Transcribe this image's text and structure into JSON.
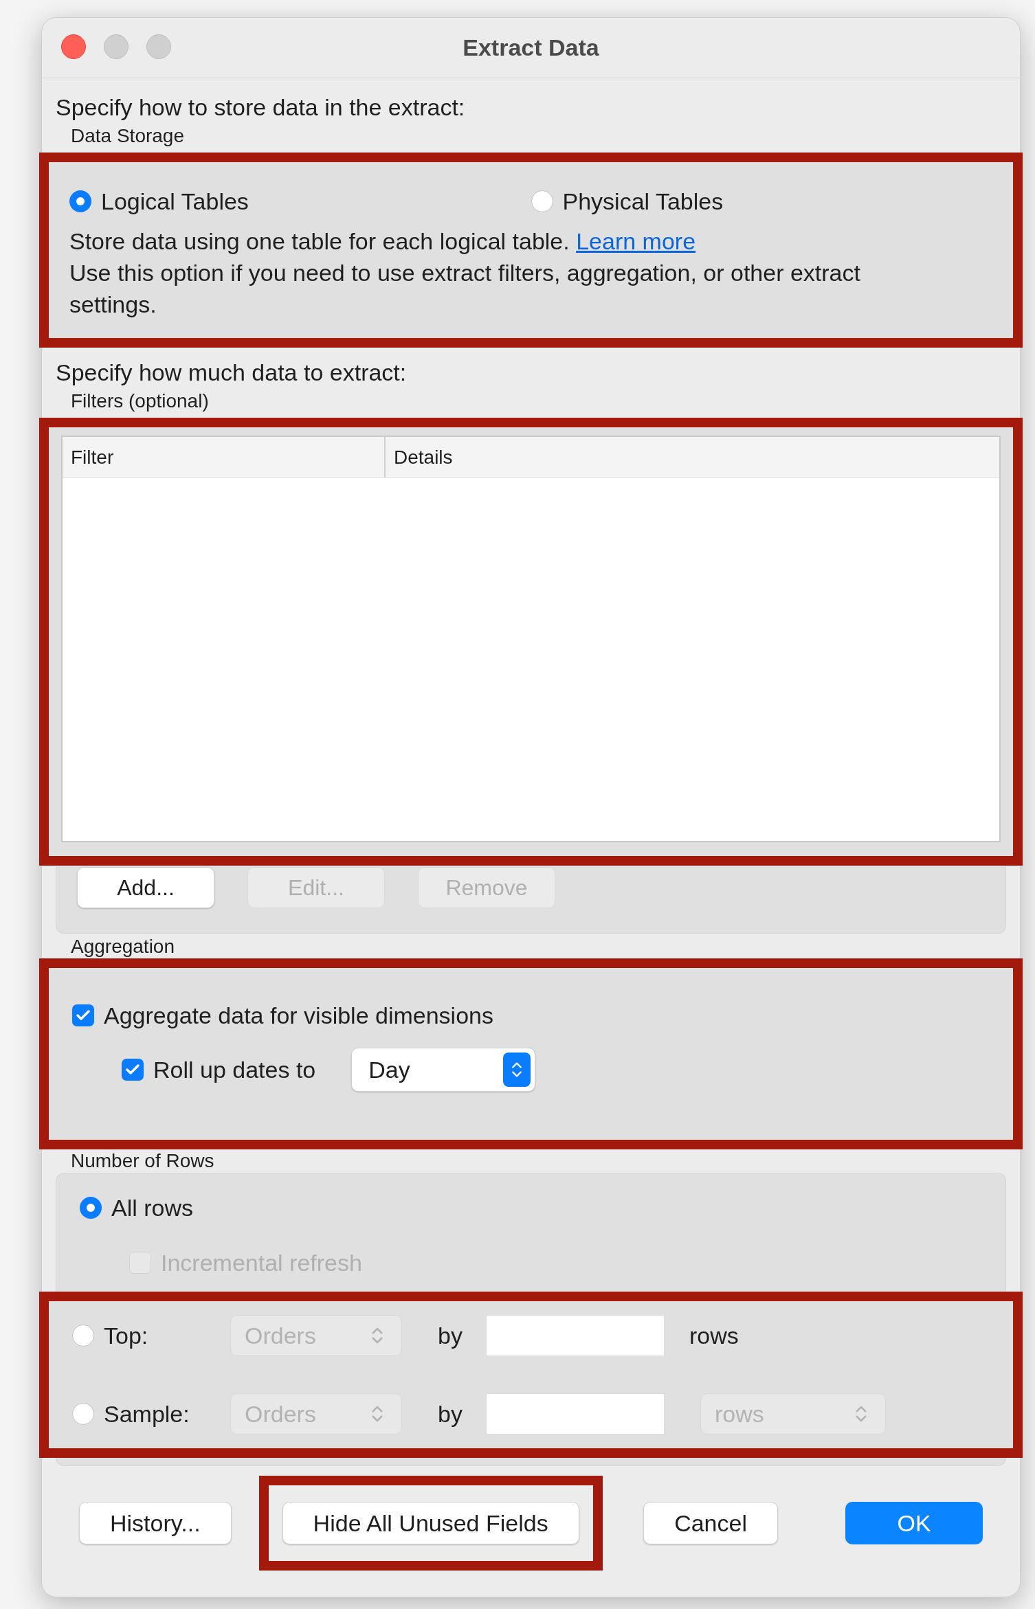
{
  "window": {
    "title": "Extract Data"
  },
  "storage": {
    "heading": "Specify how to store data in the extract:",
    "group_label": "Data Storage",
    "annotated": true,
    "options": [
      {
        "label": "Logical Tables",
        "selected": true
      },
      {
        "label": "Physical Tables",
        "selected": false
      }
    ],
    "description": "Store data using one table for each logical table.",
    "link": "Learn more",
    "note": "Use this option if you need to use extract filters, aggregation, or other extract settings."
  },
  "filters": {
    "heading": "Specify how much data to extract:",
    "group_label": "Filters (optional)",
    "annotated": true,
    "columns": [
      "Filter",
      "Details"
    ],
    "buttons": [
      {
        "label": "Add...",
        "disabled": false
      },
      {
        "label": "Edit...",
        "disabled": true
      },
      {
        "label": "Remove",
        "disabled": true
      }
    ]
  },
  "aggregation": {
    "group_label": "Aggregation",
    "annotated": true,
    "aggregate": {
      "label": "Aggregate data for visible dimensions",
      "checked": true
    },
    "rollup": {
      "label": "Roll up dates to",
      "checked": true,
      "value": "Day"
    }
  },
  "rows": {
    "group_label": "Number of Rows",
    "annotated": true,
    "all": {
      "label": "All rows",
      "selected": true
    },
    "incremental": {
      "label": "Incremental refresh",
      "checked": false,
      "disabled": true
    },
    "options": [
      {
        "label": "Top:",
        "selected": false,
        "table": "Orders",
        "by": "by",
        "unit": {
          "kind": "text",
          "label": "rows"
        }
      },
      {
        "label": "Sample:",
        "selected": false,
        "table": "Orders",
        "by": "by",
        "unit": {
          "kind": "select",
          "label": "rows"
        }
      }
    ]
  },
  "footer_buttons": [
    {
      "label": "History...",
      "kind": "normal",
      "annotated": false
    },
    {
      "label": "Hide All Unused Fields",
      "kind": "normal",
      "annotated": true
    },
    {
      "label": "Cancel",
      "kind": "normal",
      "annotated": false
    },
    {
      "label": "OK",
      "kind": "default",
      "annotated": false
    }
  ]
}
